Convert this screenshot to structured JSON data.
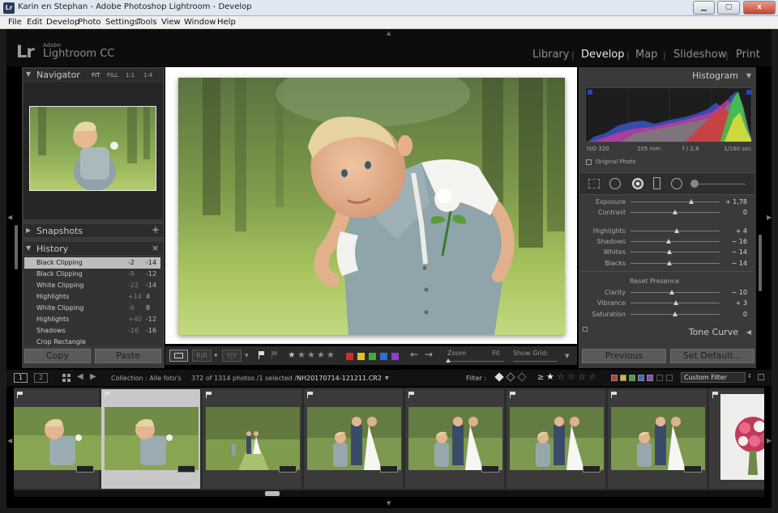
{
  "window": {
    "title": "Karin en Stephan - Adobe Photoshop Lightroom - Develop",
    "app_icon": "Lr",
    "close": "x",
    "minimize": "▁",
    "maximize": "▢"
  },
  "menu": [
    "File",
    "Edit",
    "Develop",
    "Photo",
    "Settings",
    "Tools",
    "View",
    "Window",
    "Help"
  ],
  "brand": {
    "mark": "Lr",
    "vendor": "Adobe",
    "product": "Lightroom CC"
  },
  "modules": [
    "Library",
    "Develop",
    "Map",
    "Slideshow",
    "Print"
  ],
  "navigator": {
    "title": "Navigator",
    "zoom_options": [
      "FIT",
      "FILL",
      "1:1",
      "1:4"
    ]
  },
  "snapshots": {
    "title": "Snapshots",
    "add": "+"
  },
  "history": {
    "title": "History",
    "clear": "×",
    "items": [
      {
        "name": "Black Clipping",
        "v1": "-2",
        "v2": "-14"
      },
      {
        "name": "Black Clipping",
        "v1": "-9",
        "v2": "-12"
      },
      {
        "name": "White Clipping",
        "v1": "-22",
        "v2": "-14"
      },
      {
        "name": "Highlights",
        "v1": "+14",
        "v2": "4"
      },
      {
        "name": "White Clipping",
        "v1": "-6",
        "v2": "8"
      },
      {
        "name": "Highlights",
        "v1": "+40",
        "v2": "-12"
      },
      {
        "name": "Shadows",
        "v1": "-16",
        "v2": "-16"
      },
      {
        "name": "Crop Rectangle",
        "v1": "",
        "v2": ""
      }
    ]
  },
  "left_buttons": {
    "copy": "Copy",
    "paste": "Paste"
  },
  "histogram": {
    "title": "Histogram",
    "iso": "ISO 320",
    "focal": "105 mm",
    "aperture": "f / 2,8",
    "shutter": "1/160 sec",
    "original_photo": "Original Photo"
  },
  "basic": {
    "sliders": [
      {
        "label": "Exposure",
        "value": "+ 1,78",
        "pos": 0.68
      },
      {
        "label": "Contrast",
        "value": "0",
        "pos": 0.5
      },
      {
        "label": "Highlights",
        "value": "+ 4",
        "pos": 0.52
      },
      {
        "label": "Shadows",
        "value": "− 16",
        "pos": 0.43
      },
      {
        "label": "Whites",
        "value": "− 14",
        "pos": 0.44
      },
      {
        "label": "Blacks",
        "value": "− 14",
        "pos": 0.44
      }
    ],
    "presence_title": "Reset Presence",
    "presence": [
      {
        "label": "Clarity",
        "value": "− 10",
        "pos": 0.46
      },
      {
        "label": "Vibrance",
        "value": "+ 3",
        "pos": 0.51
      },
      {
        "label": "Saturation",
        "value": "0",
        "pos": 0.5
      }
    ]
  },
  "tone_curve": {
    "title": "Tone Curve"
  },
  "right_buttons": {
    "previous": "Previous",
    "set_default": "Set Default..."
  },
  "toolbar": {
    "zoom_label": "Zoom",
    "zoom_fit": "Fit",
    "show_grid_label": "Show Grid:",
    "label_colors": [
      "#d12c2c",
      "#e0c21d",
      "#37b03b",
      "#2e6fd1",
      "#8a3fd6"
    ]
  },
  "filmstrip_bar": {
    "page1": "1",
    "page2": "2",
    "collection": "Collection : Alle foto's",
    "count": "372 of 1314 photos /1 selected /",
    "filename": "NH20170714-121211.CR2",
    "filter_label": "Filter :",
    "custom_filter": "Custom Filter",
    "gte": "≥",
    "filter_colors": [
      "#c63a3a",
      "#d4b626",
      "#3fa43f",
      "#3a6bc7",
      "#8d46c9"
    ]
  },
  "thumbs": [
    {
      "kind": "boy-lean",
      "selected": false
    },
    {
      "kind": "boy-lean",
      "selected": true
    },
    {
      "kind": "couple-far",
      "selected": false
    },
    {
      "kind": "family",
      "selected": false
    },
    {
      "kind": "family",
      "selected": false
    },
    {
      "kind": "family",
      "selected": false
    },
    {
      "kind": "family",
      "selected": false
    },
    {
      "kind": "bouquet",
      "selected": false
    }
  ]
}
